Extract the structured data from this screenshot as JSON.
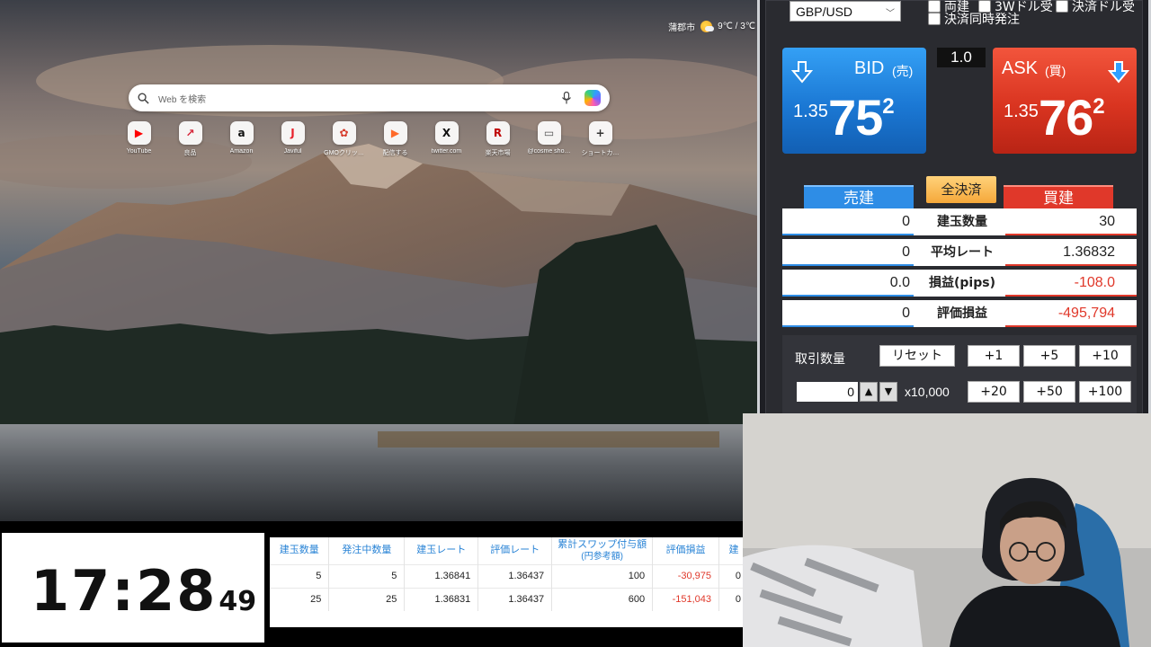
{
  "browser": {
    "weather": {
      "city": "蒲郡市",
      "temp": "9℃ / 3℃",
      "icon": "partly-cloudy-icon"
    },
    "search": {
      "placeholder": "Web を検索"
    },
    "shortcuts": [
      {
        "label": "YouTube",
        "glyph": "▶",
        "color": "#ff0000",
        "icon": "youtube-icon"
      },
      {
        "label": "良品",
        "glyph": "↗",
        "color": "#d6263a",
        "icon": "chart-icon"
      },
      {
        "label": "Amazon",
        "glyph": "a",
        "color": "#111111",
        "icon": "amazon-icon"
      },
      {
        "label": "Javiful",
        "glyph": "J",
        "color": "#e8202b",
        "icon": "javiful-icon"
      },
      {
        "label": "GMOクリッ…",
        "glyph": "✿",
        "color": "#d63a2a",
        "icon": "gmo-click-icon"
      },
      {
        "label": "配信する",
        "glyph": "▶",
        "color": "#ff6a2a",
        "icon": "stream-icon"
      },
      {
        "label": "twitter.com",
        "glyph": "X",
        "color": "#111111",
        "icon": "x-icon"
      },
      {
        "label": "楽天市場",
        "glyph": "R",
        "color": "#bf0000",
        "icon": "rakuten-icon"
      },
      {
        "label": "@cosme sho…",
        "glyph": "▭",
        "color": "#555555",
        "icon": "cosme-icon"
      },
      {
        "label": "ショートカ…",
        "glyph": "+",
        "color": "#333333",
        "icon": "add-shortcut-icon"
      }
    ]
  },
  "panel": {
    "pair": "GBP/USD",
    "options": {
      "opt1": "両建",
      "opt2": "3Wドル受",
      "opt3": "決済ドル受",
      "simul": "決済同時発注"
    },
    "spread": "1.0",
    "bid": {
      "label": "BID",
      "side": "(売)",
      "prefix": "1.35",
      "main": "75",
      "sup": "2"
    },
    "ask": {
      "label": "ASK",
      "side": "(買)",
      "prefix": "1.35",
      "main": "76",
      "sup": "2"
    },
    "sell_label": "売建",
    "buy_label": "買建",
    "closeall_label": "全決済",
    "rows": [
      {
        "left": "0",
        "mid": "建玉数量",
        "right": "30",
        "neg": false
      },
      {
        "left": "0",
        "mid": "平均レート",
        "right": "1.36832",
        "neg": false
      },
      {
        "left": "0.0",
        "mid": "損益(pips)",
        "right": "-108.0",
        "neg": true
      },
      {
        "left": "0",
        "mid": "評価損益",
        "right": "-495,794",
        "neg": true
      }
    ],
    "lot": {
      "label": "取引数量",
      "reset": "リセット",
      "value": "0",
      "unit": "x10,000",
      "up": "▲",
      "down": "▼",
      "inc1": [
        "+1",
        "+5",
        "+10"
      ],
      "inc2": [
        "+20",
        "+50",
        "+100"
      ]
    }
  },
  "clock": {
    "hm": "17:28",
    "sec": "49"
  },
  "positions": {
    "headers": [
      "建玉数量",
      "発注中数量",
      "建玉レート",
      "評価レート",
      "累計スワップ付与額",
      "評価損益",
      "建"
    ],
    "header_sub": "(円参考額)",
    "rows": [
      [
        "5",
        "5",
        "1.36841",
        "1.36437",
        "100",
        "-30,975",
        "0"
      ],
      [
        "25",
        "25",
        "1.36831",
        "1.36437",
        "600",
        "-151,043",
        "0"
      ]
    ]
  }
}
